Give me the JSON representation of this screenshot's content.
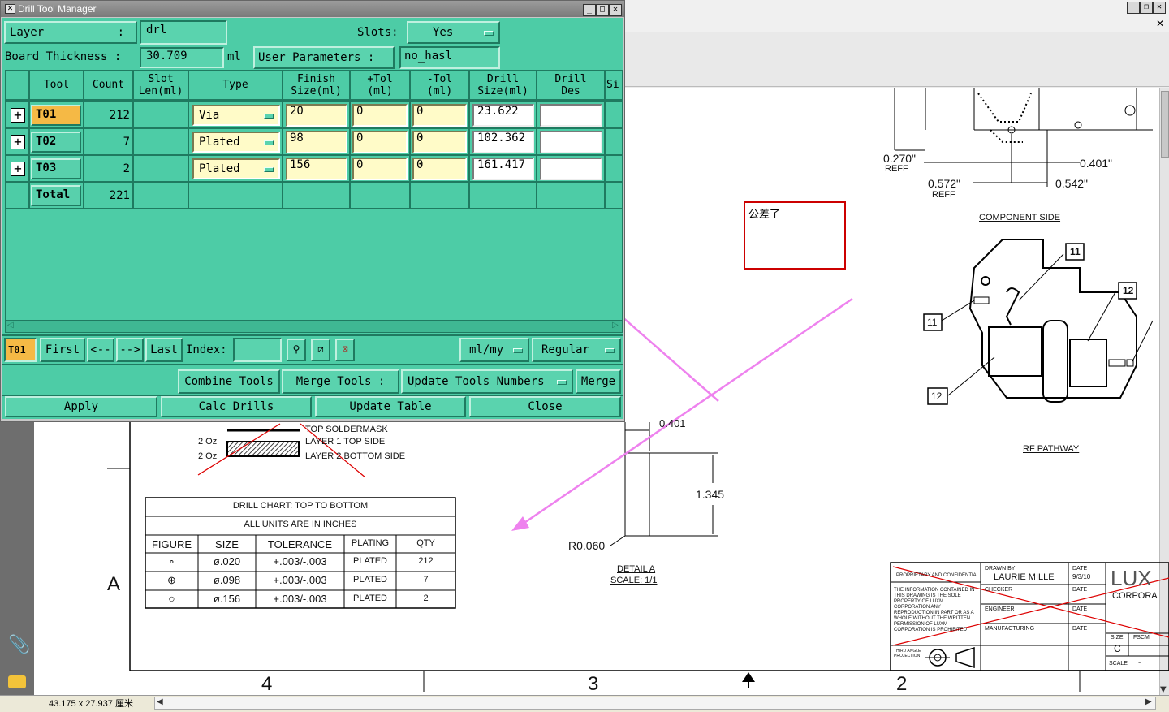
{
  "window": {
    "title": "Drill Tool Manager"
  },
  "form": {
    "layer_label": "Layer",
    "layer_colon": ":",
    "layer_value": "drl",
    "slots_label": "Slots:",
    "slots_value": "Yes",
    "board_thickness_label": "Board Thickness :",
    "board_thickness_value": "30.709",
    "board_thickness_unit": "ml",
    "user_params_label": "User Parameters :",
    "user_params_value": "no_hasl"
  },
  "table": {
    "headers": [
      "Tool",
      "Count",
      "Slot\nLen(ml)",
      "Type",
      "Finish\nSize(ml)",
      "+Tol\n(ml)",
      "-Tol\n(ml)",
      "Drill\nSize(ml)",
      "Drill\nDes",
      "Si"
    ],
    "rows": [
      {
        "tool": "T01",
        "count": "212",
        "type": "Via",
        "finish": "20",
        "ptol": "0",
        "ntol": "0",
        "drill": "23.622"
      },
      {
        "tool": "T02",
        "count": "7",
        "type": "Plated",
        "finish": "98",
        "ptol": "0",
        "ntol": "0",
        "drill": "102.362"
      },
      {
        "tool": "T03",
        "count": "2",
        "type": "Plated",
        "finish": "156",
        "ptol": "0",
        "ntol": "0",
        "drill": "161.417"
      }
    ],
    "total_label": "Total",
    "total_count": "221"
  },
  "nav": {
    "current": "T01",
    "first": "First",
    "prev": "<--",
    "next": "-->",
    "last": "Last",
    "index_label": "Index:",
    "unit": "ml/my",
    "mode": "Regular"
  },
  "actions": {
    "combine": "Combine Tools",
    "merge_tools": "Merge Tools :",
    "update_numbers": "Update Tools Numbers",
    "merge": "Merge",
    "apply": "Apply",
    "calc": "Calc Drills",
    "update_table": "Update Table",
    "close": "Close"
  },
  "annotation": {
    "note": "公差了"
  },
  "drawing": {
    "dim_0270": "0.270\"",
    "reff1": "REFF",
    "dim_0401_top": "0.401\"",
    "dim_0572": "0.572\"",
    "reff2": "REFF",
    "dim_0542": "0.542\"",
    "component_side": "COMPONENT SIDE",
    "callout_11a": "11",
    "callout_12a": "12",
    "callout_11b": "11",
    "callout_12b": "12",
    "rf_pathway": "RF PATHWAY",
    "dim_0401": "0.401",
    "dim_1345": "1.345",
    "r0060": "R0.060",
    "detail_a": "DETAIL A",
    "scale_detail": "SCALE: 1/1",
    "top_soldermask": "TOP SOLDERMASK",
    "oz1": "2 Oz",
    "layer1": "LAYER 1 TOP SIDE",
    "oz2": "2 Oz",
    "layer2": "LAYER 2 BOTTOM SIDE",
    "zone_a": "A",
    "zone_4": "4",
    "zone_3": "3",
    "zone_2": "2",
    "drill_chart_title": "DRILL CHART: TOP TO BOTTOM",
    "drill_chart_units": "ALL UNITS ARE IN INCHES",
    "chart_headers": [
      "FIGURE",
      "SIZE",
      "TOLERANCE",
      "PLATING",
      "QTY"
    ],
    "chart_rows": [
      {
        "fig": "∘",
        "size": "ø.020",
        "tol": "+.003/-.003",
        "plating": "PLATED",
        "qty": "212"
      },
      {
        "fig": "⊕",
        "size": "ø.098",
        "tol": "+.003/-.003",
        "plating": "PLATED",
        "qty": "7"
      },
      {
        "fig": "○",
        "size": "ø.156",
        "tol": "+.003/-.003",
        "plating": "PLATED",
        "qty": "2"
      }
    ],
    "tb_prop": "PROPRIETARY AND CONFIDENTIAL",
    "tb_info": "THE INFORMATION CONTAINED IN THIS DRAWING IS THE SOLE PROPERTY OF LUXM CORPORATION ANY REPRODUCTION IN PART OR AS A WHOLE WITHOUT THE WRITTEN PERMISSION OF LUXM CORPORATION IS PROHIBITED",
    "tb_drawn_by": "DRAWN BY",
    "tb_drawn_name": "LAURIE MILLE",
    "tb_date1": "DATE",
    "tb_date_val": "9/3/10",
    "tb_checker": "CHECKER",
    "tb_date2": "DATE",
    "tb_engineer": "ENGINEER",
    "tb_date3": "DATE",
    "tb_mfg": "MANUFACTURING",
    "tb_date4": "DATE",
    "tb_third": "THIRD ANGLE PROJECTION",
    "tb_logo": "LUX",
    "tb_corp": "CORPORA",
    "tb_size": "SIZE",
    "tb_fscm": "FSCM",
    "tb_size_val": "C",
    "tb_scale": "SCALE",
    "tb_scale_val": "-"
  },
  "viewer": {
    "page_size": "43.175 x 27.937 厘米"
  },
  "colors": {
    "dialog_bg": "#4dcca6",
    "yellow_field": "#fffbc8",
    "arrow": "#ee82ee",
    "note_border": "#cc0000"
  }
}
